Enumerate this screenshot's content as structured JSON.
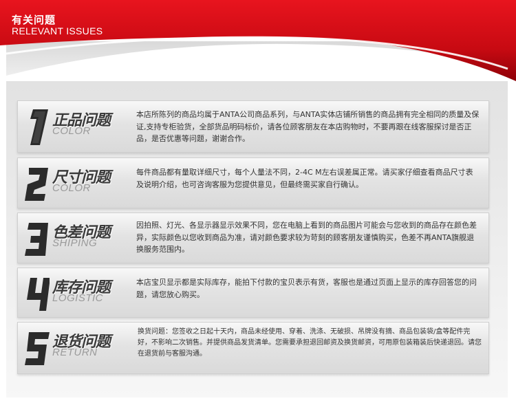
{
  "header": {
    "title": "有关问题",
    "subtitle": "RELEVANT ISSUES"
  },
  "colors": {
    "brand_red": "#d0101a",
    "dark_red": "#8e0008"
  },
  "items": [
    {
      "number": "1",
      "title_cn": "正品问题",
      "title_en": "COLOR",
      "body": "本店所陈列的商品均属于ANTA公司商品系列，与ANTA实体店铺所销售的商品拥有完全相同的质量及保证,支持专柜验货，全部货品明码标价，请各位顾客朋友在本店购物时，不要再跟在线客服探讨是否正品，是否优惠等问题，谢谢合作。"
    },
    {
      "number": "2",
      "title_cn": "尺寸问题",
      "title_en": "COLOR",
      "body": "每件商品都有量取详细尺寸，每个人量法不同，2-4C M左右误差属正常。请买家仔细查看商品尺寸表及说明介绍，也可咨询客服为您提供意见，但最终需买家自行确认。"
    },
    {
      "number": "3",
      "title_cn": "色差问题",
      "title_en": "SHIPING",
      "body": "因拍照、灯光、各显示器显示效果不同，您在电脑上看到的商品图片可能会与您收到的商品存在颜色差异，实际颜色以您收到商品为准，请对颜色要求较为苛刻的顾客朋友谨慎购买，色差不再ANTA旗舰退换服务范围内。"
    },
    {
      "number": "4",
      "title_cn": "库存问题",
      "title_en": "LOGISTIC",
      "body": "本店宝贝显示都是实际库存，能拍下付款的宝贝表示有货，客服也是通过页面上显示的库存回答您的问题，请您放心购买。"
    },
    {
      "number": "5",
      "title_cn": "退货问题",
      "title_en": "RETURN",
      "body": "换货问题：您签收之日起十天内，商品未经使用、穿着、洗涤、无破损、吊牌没有摘、商品包装袋/盒等配件完好，不影响二次销售。并提供商品发货清单。您需要承担退回邮资及换货邮资，可用原包装箱装后快递退回。请您在退货前与客服沟通。"
    }
  ]
}
